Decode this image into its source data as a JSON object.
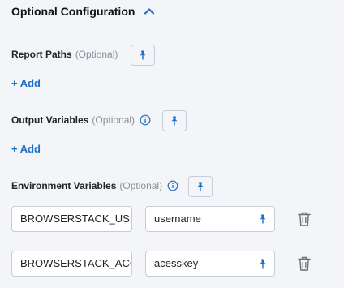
{
  "section": {
    "title": "Optional Configuration",
    "collapse_icon": "chevron-up-icon"
  },
  "report_paths": {
    "label": "Report Paths",
    "optional": "(Optional)",
    "add_label": "+ Add"
  },
  "output_variables": {
    "label": "Output Variables",
    "optional": "(Optional)",
    "add_label": "+ Add"
  },
  "environment_variables": {
    "label": "Environment Variables",
    "optional": "(Optional)",
    "rows": [
      {
        "key": "BROWSERSTACK_USERNAME",
        "value": "username"
      },
      {
        "key": "BROWSERSTACK_ACCESS_KEY",
        "value": "acesskey"
      }
    ]
  },
  "colors": {
    "accent": "#1f6fc5",
    "border": "#c9ccd6",
    "background": "#f4f5f8"
  }
}
